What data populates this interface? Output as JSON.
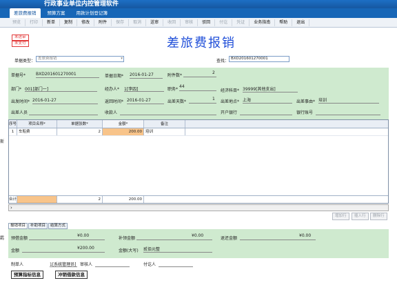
{
  "app": {
    "title": "行政事业单位内控管理软件"
  },
  "nav": {
    "tabs": [
      "差旅费报销",
      "预算方案",
      "用款计划登记簿"
    ]
  },
  "toolbar": {
    "buttons": [
      "预览",
      "打印",
      "新单",
      "复制",
      "修改",
      "附件",
      "保存",
      "取消",
      "送审",
      "收回",
      "审核",
      "驳回",
      "付讫",
      "凭证",
      "业务指南",
      "帮助",
      "退出"
    ]
  },
  "stamps": {
    "not_sent": "未送审",
    "not_paid": "未支付"
  },
  "doc": {
    "title": "差旅费报销"
  },
  "type": {
    "label": "单据类型：",
    "value": "差旅费报销",
    "search_label": "查找：",
    "search_value": "BXD201601270001"
  },
  "fields": {
    "doc_no_label": "单据号*",
    "doc_no": "BXD201601270001",
    "doc_date_label": "单据日期*",
    "doc_date": "2016-01-27",
    "attach_label": "附件数*",
    "attach": "2",
    "dept_label": "部门*",
    "dept": "001[部门一]",
    "handler_label": "经办人*",
    "handler": "1[李四]",
    "title_label": "职务*",
    "title": "44",
    "account_label": "经济科目*",
    "account": "39999[其他支出]",
    "depart_label": "出发时间*",
    "depart": "2016-01-27",
    "return_label": "返回时间*",
    "return": "2016-01-27",
    "days_label": "出差天数*",
    "days": "1",
    "place_label": "出差地点*",
    "place": "上海",
    "reason_label": "出差事由*",
    "reason": "培训",
    "people_label": "出差人员",
    "payee_label": "收款人",
    "bank_label": "开户银行",
    "bankno_label": "银行账号"
  },
  "grid": {
    "headers": [
      "序号",
      "项目名称*",
      "单据张数*",
      "金额*",
      "备注"
    ],
    "rows": [
      {
        "no": "1",
        "name": "车船费",
        "count": "2",
        "amount": "200.00",
        "note": "培训"
      }
    ],
    "footer": {
      "label": "合计",
      "count": "2",
      "amount": "200.00"
    }
  },
  "actions": {
    "add": "增加行",
    "insert": "插入行",
    "delete": "删除行"
  },
  "subtabs": [
    "报销项目",
    "补助项目",
    "结算方式"
  ],
  "summary": {
    "loan_label": "预借金额",
    "loan": "¥0.00",
    "refund_label": "补领金额",
    "refund": "¥0.00",
    "return_label": "退还金额",
    "return": "¥0.00",
    "total_label": "金额",
    "total": "¥200.00",
    "total_cn_label": "金额(大写)",
    "total_cn": "贰佰元整"
  },
  "footer": {
    "maker_label": "制单人",
    "maker": "1[系统管理员]",
    "reviewer_label": "审核人",
    "payer_label": "付讫人",
    "btn_budget": "预算指标信息",
    "btn_loan": "冲销借款信息"
  },
  "side": {
    "label1": "斯",
    "label2": "羁"
  }
}
